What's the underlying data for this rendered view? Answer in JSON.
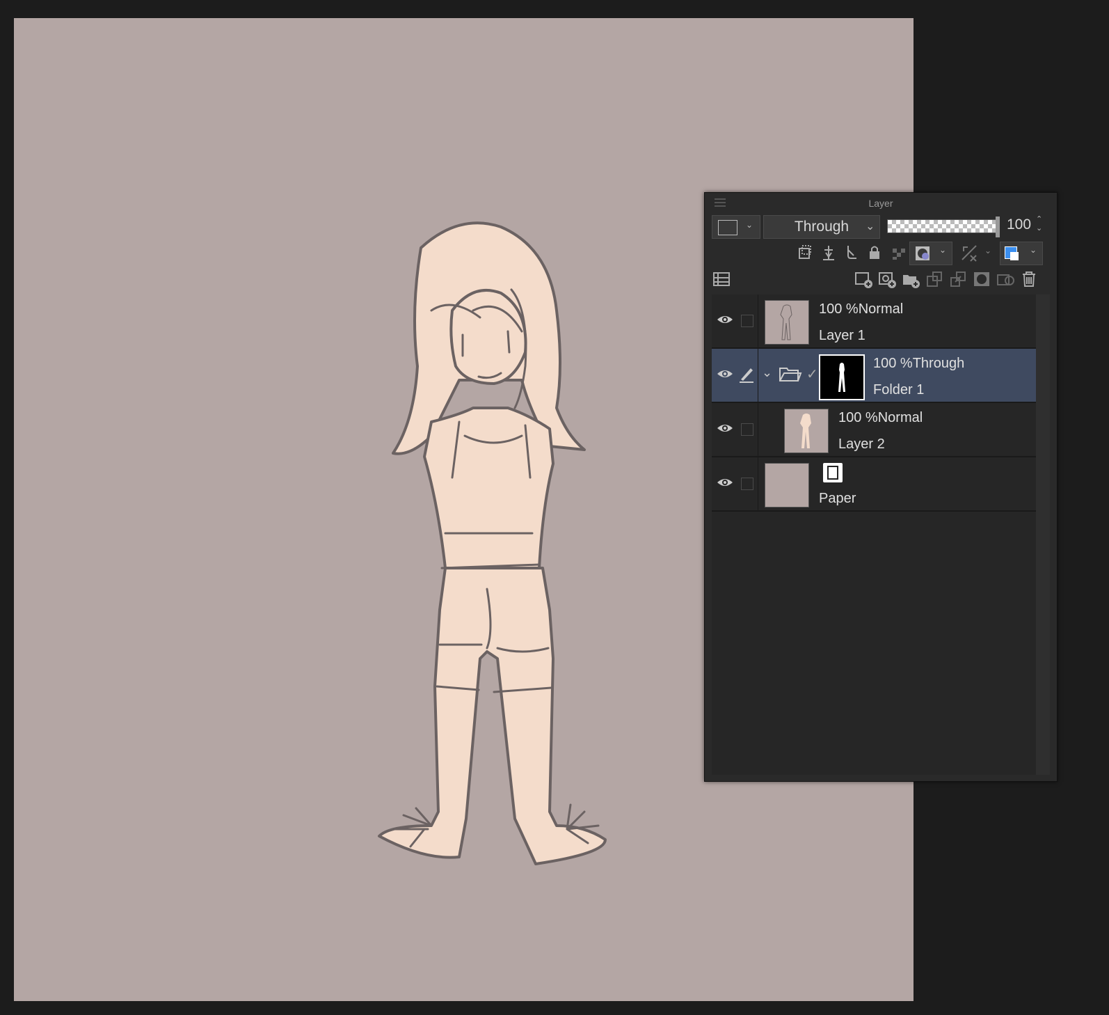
{
  "panel": {
    "title": "Layer",
    "blend_mode": "Through",
    "opacity": "100",
    "accent_color": "#3f4a60"
  },
  "icons": [
    "menu-icon",
    "color-swatch-icon",
    "chevron-down-icon",
    "clip-icon",
    "reference-icon",
    "draft-icon",
    "lock-icon",
    "lock-transparent-icon",
    "mask-icon",
    "ruler-icon",
    "layer-color-icon",
    "layer-property-icon",
    "new-raster-layer-icon",
    "new-vector-layer-icon",
    "new-folder-icon",
    "transfer-down-icon",
    "combine-down-icon",
    "create-mask-icon",
    "apply-mask-icon",
    "delete-icon",
    "eye-icon",
    "pen-icon",
    "folder-open-icon",
    "paper-icon"
  ],
  "layers": [
    {
      "opacity": "100 %",
      "mode": "Normal",
      "name": "Layer 1"
    },
    {
      "opacity": "100 %",
      "mode": "Through",
      "name": "Folder 1"
    },
    {
      "opacity": "100 %",
      "mode": "Normal",
      "name": "Layer 2"
    },
    {
      "name": "Paper"
    }
  ]
}
